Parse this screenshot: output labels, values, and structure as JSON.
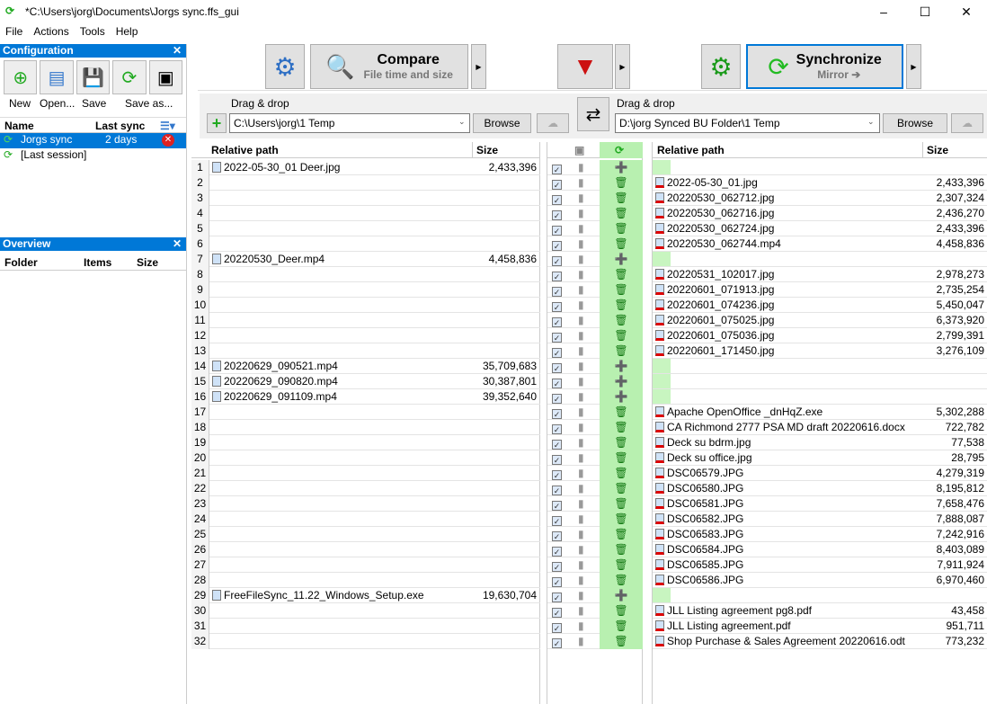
{
  "window": {
    "title": "*C:\\Users\\jorg\\Documents\\Jorgs sync.ffs_gui"
  },
  "menu": [
    "File",
    "Actions",
    "Tools",
    "Help"
  ],
  "config": {
    "title": "Configuration",
    "buttons": [
      "New",
      "Open...",
      "Save",
      "Save as..."
    ],
    "col_name": "Name",
    "col_last": "Last sync",
    "items": [
      {
        "name": "Jorgs sync",
        "last": "2 days"
      },
      {
        "name": "[Last session]",
        "last": ""
      }
    ]
  },
  "overview": {
    "title": "Overview",
    "cols": [
      "Folder",
      "Items",
      "Size"
    ]
  },
  "toolbar": {
    "compare": "Compare",
    "compare_sub": "File time and size",
    "sync": "Synchronize",
    "sync_sub": "Mirror ➔"
  },
  "left_folder": {
    "label": "Drag & drop",
    "path": "C:\\Users\\jorg\\1 Temp",
    "browse": "Browse"
  },
  "right_folder": {
    "label": "Drag & drop",
    "path": "D:\\jorg Synced BU Folder\\1 Temp",
    "browse": "Browse"
  },
  "grid": {
    "col_path": "Relative path",
    "col_size": "Size",
    "left": {
      "1": [
        "2022-05-30_01 Deer.jpg",
        "2,433,396"
      ],
      "7": [
        "20220530_Deer.mp4",
        "4,458,836"
      ],
      "14": [
        "20220629_090521.mp4",
        "35,709,683"
      ],
      "15": [
        "20220629_090820.mp4",
        "30,387,801"
      ],
      "16": [
        "20220629_091109.mp4",
        "39,352,640"
      ],
      "29": [
        "FreeFileSync_11.22_Windows_Setup.exe",
        "19,630,704"
      ]
    },
    "right": {
      "2": [
        "2022-05-30_01.jpg",
        "2,433,396"
      ],
      "3": [
        "20220530_062712.jpg",
        "2,307,324"
      ],
      "4": [
        "20220530_062716.jpg",
        "2,436,270"
      ],
      "5": [
        "20220530_062724.jpg",
        "2,433,396"
      ],
      "6": [
        "20220530_062744.mp4",
        "4,458,836"
      ],
      "8": [
        "20220531_102017.jpg",
        "2,978,273"
      ],
      "9": [
        "20220601_071913.jpg",
        "2,735,254"
      ],
      "10": [
        "20220601_074236.jpg",
        "5,450,047"
      ],
      "11": [
        "20220601_075025.jpg",
        "6,373,920"
      ],
      "12": [
        "20220601_075036.jpg",
        "2,799,391"
      ],
      "13": [
        "20220601_171450.jpg",
        "3,276,109"
      ],
      "17": [
        "Apache OpenOffice _dnHqZ.exe",
        "5,302,288"
      ],
      "18": [
        "CA Richmond 2777 PSA MD draft 20220616.docx",
        "722,782"
      ],
      "19": [
        "Deck su bdrm.jpg",
        "77,538"
      ],
      "20": [
        "Deck su office.jpg",
        "28,795"
      ],
      "21": [
        "DSC06579.JPG",
        "4,279,319"
      ],
      "22": [
        "DSC06580.JPG",
        "8,195,812"
      ],
      "23": [
        "DSC06581.JPG",
        "7,658,476"
      ],
      "24": [
        "DSC06582.JPG",
        "7,888,087"
      ],
      "25": [
        "DSC06583.JPG",
        "7,242,916"
      ],
      "26": [
        "DSC06584.JPG",
        "8,403,089"
      ],
      "27": [
        "DSC06585.JPG",
        "7,911,924"
      ],
      "28": [
        "DSC06586.JPG",
        "6,970,460"
      ],
      "30": [
        "JLL Listing agreement pg8.pdf",
        "43,458"
      ],
      "31": [
        "JLL Listing agreement.pdf",
        "951,711"
      ],
      "32": [
        "Shop Purchase & Sales Agreement 20220616.odt",
        "773,232"
      ]
    },
    "row_count": 32,
    "create_rows": [
      1,
      7,
      14,
      15,
      16,
      29
    ]
  },
  "colors": {
    "accent": "#0078d7",
    "action_bg": "#b8f0b0"
  }
}
